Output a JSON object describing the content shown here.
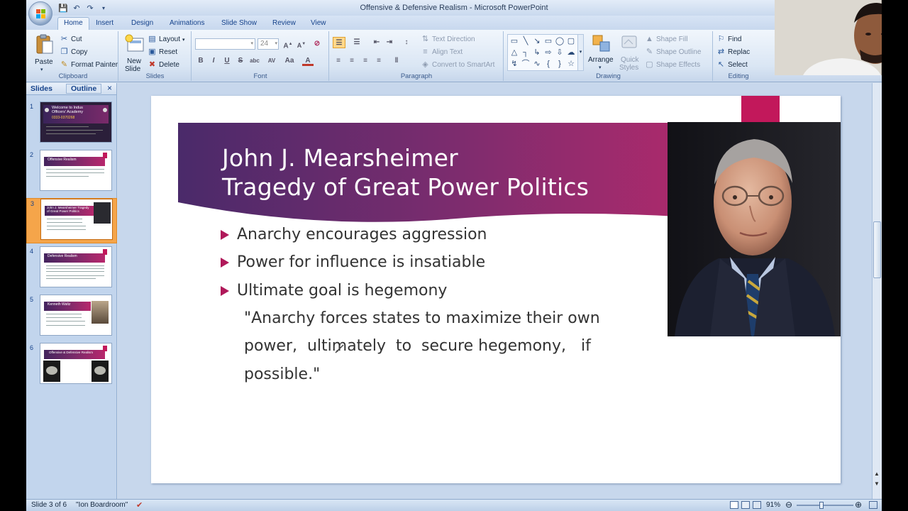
{
  "window": {
    "title": "Offensive & Defensive Realism - Microsoft PowerPoint"
  },
  "ribbon": {
    "tabs": [
      "Home",
      "Insert",
      "Design",
      "Animations",
      "Slide Show",
      "Review",
      "View"
    ],
    "active_tab": "Home",
    "clipboard": {
      "paste": "Paste",
      "cut": "Cut",
      "copy": "Copy",
      "format_painter": "Format Painter",
      "label": "Clipboard"
    },
    "slides": {
      "new_slide_line1": "New",
      "new_slide_line2": "Slide",
      "layout": "Layout",
      "reset": "Reset",
      "delete": "Delete",
      "label": "Slides"
    },
    "font": {
      "font_size": "24",
      "label": "Font",
      "bold": "B",
      "italic": "I",
      "underline": "U",
      "strike": "S",
      "shadow": "abc",
      "spacing": "AV",
      "case": "Aa",
      "color": "A"
    },
    "paragraph": {
      "text_direction": "Text Direction",
      "align_text": "Align Text",
      "convert_smartart": "Convert to SmartArt",
      "label": "Paragraph"
    },
    "drawing": {
      "arrange": "Arrange",
      "quick_styles_line1": "Quick",
      "quick_styles_line2": "Styles",
      "shape_fill": "Shape Fill",
      "shape_outline": "Shape Outline",
      "shape_effects": "Shape Effects",
      "label": "Drawing"
    },
    "editing": {
      "find": "Find",
      "replace": "Replac",
      "select": "Select",
      "label": "Editing"
    }
  },
  "pane": {
    "tabs": [
      "Slides",
      "Outline"
    ],
    "close": "×",
    "thumbnails": [
      {
        "num": "1",
        "title": "Welcome to Indus Officers' Academy",
        "subtitle": "0333-0370268"
      },
      {
        "num": "2",
        "title": "Offensive Realism"
      },
      {
        "num": "3",
        "title": "John J. Mearsheimer Tragedy of Great Power Politics"
      },
      {
        "num": "4",
        "title": "Defensive Realism"
      },
      {
        "num": "5",
        "title": "Kenneth Waltz"
      },
      {
        "num": "6",
        "title": "Offensive & Defensive Realism"
      }
    ],
    "selected_index": 2
  },
  "slide": {
    "title_line1": "John J. Mearsheimer",
    "title_line2": "Tragedy of Great Power Politics",
    "bullets": [
      "Anarchy encourages aggression",
      "Power for influence is insatiable",
      "Ultimate goal is hegemony"
    ],
    "quote_lines": [
      "\"Anarchy forces states to maximize their own",
      "power,  ultimately  to  secure hegemony,   if",
      "possible.\""
    ],
    "accent_color": "#c2185b",
    "banner_colors": [
      "#4a2a6a",
      "#7b2c6e",
      "#b32a6c"
    ]
  },
  "statusbar": {
    "slide_info": "Slide 3 of 6",
    "theme": "\"Ion Boardroom\"",
    "zoom": "91%"
  }
}
